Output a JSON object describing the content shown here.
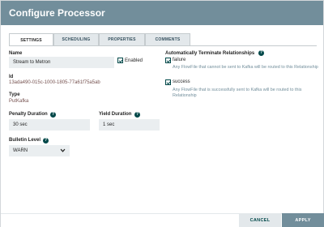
{
  "dialog": {
    "title": "Configure Processor"
  },
  "tabs": [
    {
      "label": "SETTINGS",
      "active": true
    },
    {
      "label": "SCHEDULING",
      "active": false
    },
    {
      "label": "PROPERTIES",
      "active": false
    },
    {
      "label": "COMMENTS",
      "active": false
    }
  ],
  "settings": {
    "name_label": "Name",
    "name_value": "Stream to Metron",
    "enabled_label": "Enabled",
    "enabled_checked": true,
    "id_label": "Id",
    "id_value": "13ada490-015c-1000-1805-77a61f75a5ab",
    "type_label": "Type",
    "type_value": "PutKafka",
    "penalty_label": "Penalty Duration",
    "penalty_value": "30 sec",
    "yield_label": "Yield Duration",
    "yield_value": "1 sec",
    "bulletin_label": "Bulletin Level",
    "bulletin_value": "WARN"
  },
  "relationships": {
    "header": "Automatically Terminate Relationships",
    "items": [
      {
        "name": "failure",
        "checked": true,
        "description": "Any FlowFile that cannot be sent to Kafka will be routed to this Relationship"
      },
      {
        "name": "success",
        "checked": true,
        "description": "Any FlowFile that is successfully sent to Kafka will be routed to this Relationship"
      }
    ]
  },
  "help_icon_glyph": "?",
  "footer": {
    "cancel_label": "CANCEL",
    "apply_label": "APPLY"
  },
  "colors": {
    "titlebar": "#728e9b",
    "accent": "#004849",
    "value_text": "#775351",
    "input_bg": "#eaeef0",
    "apply_bg": "#728e9b"
  },
  "icons": {
    "help": "help-icon",
    "checkbox": "checkbox-icon",
    "dropdown": "chevron-down-icon"
  }
}
